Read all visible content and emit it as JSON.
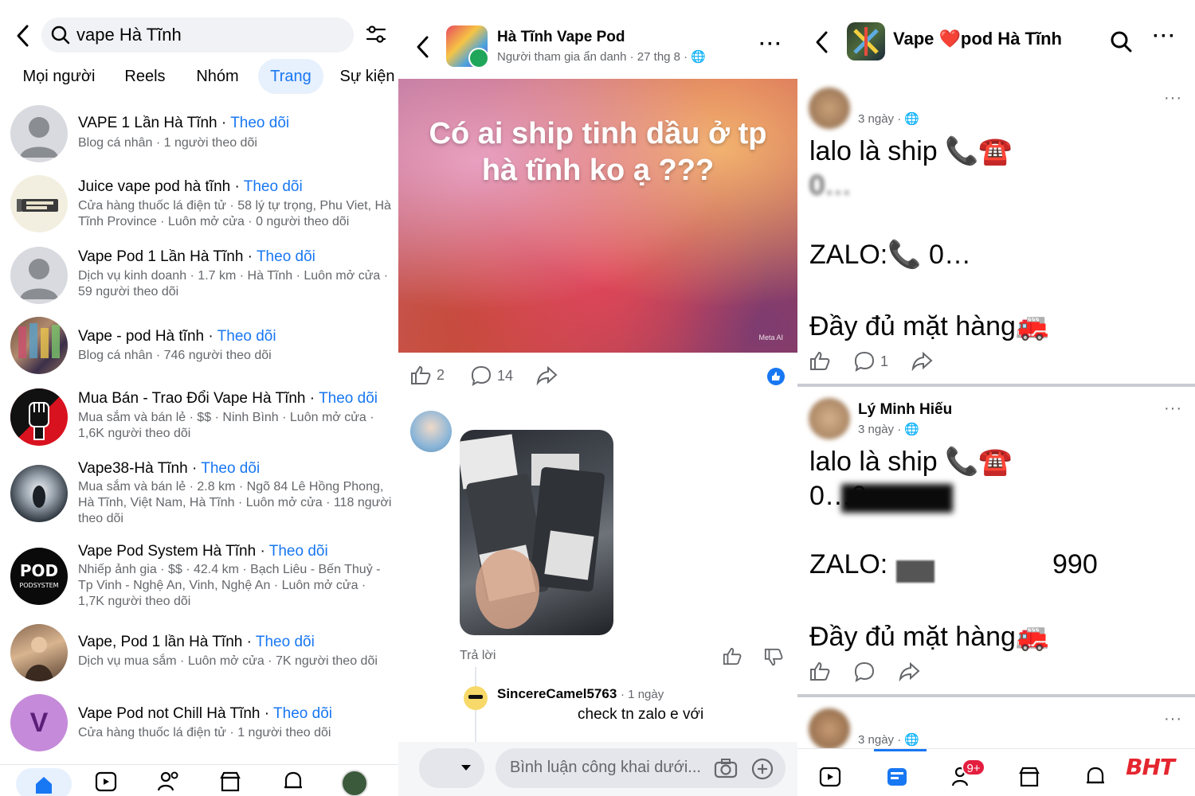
{
  "colors": {
    "accent": "#1877f2",
    "secondary_text": "#65676b",
    "badge": "#e41e3f",
    "watermark": "#e4262f"
  },
  "panel1": {
    "search": {
      "value": "vape Hà Tĩnh"
    },
    "tabs": [
      "Mọi người",
      "Reels",
      "Nhóm",
      "Trang",
      "Sự kiện"
    ],
    "active_tab": "Trang",
    "results": [
      {
        "name": "VAPE 1 Lần Hà Tĩnh",
        "follow": "Theo dõi",
        "sub": "Blog cá nhân · 1 người theo dõi",
        "avatar": "default-avatar"
      },
      {
        "name": "Juice vape pod hà tĩnh ",
        "follow": "Theo dõi",
        "sub": "Cửa hàng thuốc lá điện tử · 58 lý tự trọng, Phu Viet, Hà Tĩnh Province · Luôn mở cửa · 0 người theo dõi",
        "avatar": "vape-shop-logo"
      },
      {
        "name": "Vape Pod 1 Lần Hà Tĩnh",
        "follow": "Theo dõi",
        "sub": "Dịch vụ kinh doanh · 1.7 km · Hà Tĩnh · Luôn mở cửa · 59 người theo dõi",
        "avatar": "default-avatar"
      },
      {
        "name": "Vape - pod Hà tĩnh",
        "follow": "Theo dõi",
        "sub": "Blog cá nhân · 746 người theo dõi",
        "avatar": "product-photo"
      },
      {
        "name": "Mua Bán - Trao Đổi Vape Hà Tĩnh",
        "follow": "Theo dõi",
        "sub": "Mua sắm và bán lẻ · $$ · Ninh Bình · Luôn mở cửa · 1,6K người theo dõi",
        "avatar": "fist-logo"
      },
      {
        "name": "Vape38-Hà Tĩnh",
        "follow": "Theo dõi",
        "sub": "Mua sắm và bán lẻ · 2.8 km · Ngõ 84 Lê Hồng Phong, Hà Tĩnh, Việt Nam, Hà Tĩnh · Luôn mở cửa · 118 người theo dõi",
        "avatar": "smoke-photo"
      },
      {
        "name": "Vape Pod System Hà Tĩnh",
        "follow": "Theo dõi",
        "sub": "Nhiếp ảnh gia · $$ · 42.4 km · Bạch Liêu - Bến Thuỷ - Tp Vinh - Nghệ An, Vinh, Nghệ An · Luôn mở cửa · 1,7K người theo dõi",
        "avatar": "podsystem-logo"
      },
      {
        "name": "Vape, Pod 1 lần Hà Tĩnh",
        "follow": "Theo dõi",
        "sub": "Dịch vụ mua sắm · Luôn mở cửa · 7K người theo dõi",
        "avatar": "person-photo"
      },
      {
        "name": "Vape Pod not Chill Hà Tĩnh",
        "follow": "Theo dõi",
        "sub": "Cửa hàng thuốc lá điện tử · 1 người theo dõi",
        "avatar": "letter-avatar",
        "avatar_letter": "V"
      }
    ],
    "podsystem_logo_text": "PODSYSTEM",
    "nav": [
      "home-icon",
      "video-icon",
      "friends-icon",
      "marketplace-icon",
      "bell-icon",
      "profile-avatar"
    ]
  },
  "panel2": {
    "group_name": "Hà Tĩnh Vape Pod",
    "meta": "Người tham gia ẩn danh · 27 thg 8 ·",
    "post_text": "Có ai ship tinh dầu ở tp hà tĩnh ko ạ ???",
    "meta_ai_label": "Meta AI",
    "likes": "2",
    "comments": "14",
    "reply_label": "Trả lời",
    "comment2_name": "SincereCamel5763",
    "comment2_time": "· 1 ngày",
    "comment2_text": "check tn zalo e với",
    "comment_placeholder": "Bình luận công khai dưới..."
  },
  "panel3": {
    "page_title": "Vape ❤️pod Hà Tĩnh",
    "posts": [
      {
        "name": "",
        "time": "3 ngày ·",
        "line1": "lalo là ship 📞☎️",
        "line2": "0…",
        "line3": "ZALO:📞 0…",
        "line4": "Đầy đủ mặt hàng🚒",
        "comments": "1"
      },
      {
        "name": "Lý Minh Hiếu",
        "time": "3 ngày ·",
        "line1": "lalo là ship 📞☎️",
        "line2": "0…0",
        "line3": "ZALO:",
        "line3b": "990",
        "line4": "Đầy đủ mặt hàng🚒",
        "comments": ""
      },
      {
        "name": "",
        "time": "3 ngày ·"
      }
    ],
    "notification_badge": "9+",
    "watermark": "BHT"
  }
}
